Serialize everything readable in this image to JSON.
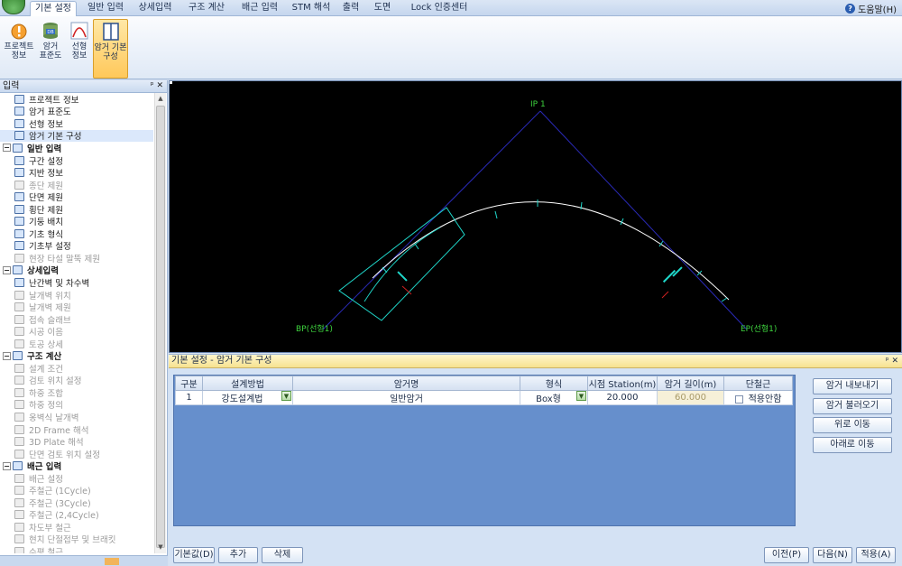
{
  "tabs": [
    "기본 설정",
    "일반 입력",
    "상세입력",
    "구조 계산",
    "배근 입력",
    "STM 해석",
    "출력",
    "도면",
    "Lock 인증센터"
  ],
  "help": {
    "label": "도움말(H)"
  },
  "ribbon": {
    "buttons": [
      {
        "line1": "프로젝트",
        "line2": "정보",
        "icon": "project-info-icon"
      },
      {
        "line1": "암거",
        "line2": "표준도",
        "icon": "database-icon"
      },
      {
        "line1": "선형",
        "line2": "정보",
        "icon": "curve-icon"
      },
      {
        "line1": "암거 기본",
        "line2": "구성",
        "icon": "box-frame-icon"
      }
    ]
  },
  "left_panel": {
    "title": "입력",
    "pin": "ᵖ ✕",
    "items": [
      {
        "label": "프로젝트 정보",
        "type": "child",
        "state": "normal"
      },
      {
        "label": "암거 표준도",
        "type": "child",
        "state": "normal"
      },
      {
        "label": "선형 정보",
        "type": "child",
        "state": "normal"
      },
      {
        "label": "암거 기본 구성",
        "type": "child",
        "state": "selected"
      },
      {
        "label": "일반 입력",
        "type": "group"
      },
      {
        "label": "구간 설정",
        "type": "child",
        "state": "normal"
      },
      {
        "label": "지반 정보",
        "type": "child",
        "state": "normal"
      },
      {
        "label": "종단 제원",
        "type": "child",
        "state": "disabled"
      },
      {
        "label": "단면 제원",
        "type": "child",
        "state": "normal"
      },
      {
        "label": "횡단 제원",
        "type": "child",
        "state": "normal"
      },
      {
        "label": "기둥 배치",
        "type": "child",
        "state": "normal"
      },
      {
        "label": "기초 형식",
        "type": "child",
        "state": "normal"
      },
      {
        "label": "기초부 설정",
        "type": "child",
        "state": "normal"
      },
      {
        "label": "현장 타설 말뚝 제원",
        "type": "child",
        "state": "disabled"
      },
      {
        "label": "상세입력",
        "type": "group"
      },
      {
        "label": "난간벽 및 차수벽",
        "type": "child",
        "state": "normal"
      },
      {
        "label": "날개벽 위치",
        "type": "child",
        "state": "disabled"
      },
      {
        "label": "날개벽 제원",
        "type": "child",
        "state": "disabled"
      },
      {
        "label": "접속 슬래브",
        "type": "child",
        "state": "disabled"
      },
      {
        "label": "시공 이음",
        "type": "child",
        "state": "disabled"
      },
      {
        "label": "토공 상세",
        "type": "child",
        "state": "disabled"
      },
      {
        "label": "구조 계산",
        "type": "group"
      },
      {
        "label": "설계 조건",
        "type": "child",
        "state": "disabled"
      },
      {
        "label": "검토 위치 설정",
        "type": "child",
        "state": "disabled"
      },
      {
        "label": "하중 조합",
        "type": "child",
        "state": "disabled"
      },
      {
        "label": "하중 정의",
        "type": "child",
        "state": "disabled"
      },
      {
        "label": "옹벽식 날개벽",
        "type": "child",
        "state": "disabled"
      },
      {
        "label": "2D Frame 해석",
        "type": "child",
        "state": "disabled"
      },
      {
        "label": "3D Plate 해석",
        "type": "child",
        "state": "disabled"
      },
      {
        "label": "단면 검토 위치 설정",
        "type": "child",
        "state": "disabled"
      },
      {
        "label": "배근 입력",
        "type": "group"
      },
      {
        "label": "배근 설정",
        "type": "child",
        "state": "disabled"
      },
      {
        "label": "주철근 (1Cycle)",
        "type": "child",
        "state": "disabled"
      },
      {
        "label": "주철근 (3Cycle)",
        "type": "child",
        "state": "disabled"
      },
      {
        "label": "주철근 (2,4Cycle)",
        "type": "child",
        "state": "disabled"
      },
      {
        "label": "차도부 철근",
        "type": "child",
        "state": "disabled"
      },
      {
        "label": "현치 단절접부 및 브래킷",
        "type": "child",
        "state": "disabled"
      },
      {
        "label": "수평 철근",
        "type": "child",
        "state": "disabled"
      }
    ]
  },
  "viewport": {
    "labels": {
      "ip": "IP 1",
      "bp": "BP(선형1)",
      "ep": "EP(선형1)"
    }
  },
  "bottom_panel": {
    "title": "기본 설정 - 암거 기본 구성",
    "pin": "ᵖ ✕",
    "columns": [
      "구분",
      "설계방법",
      "암거명",
      "형식",
      "시점 Station(m)",
      "암거 길이(m)",
      "단철근"
    ],
    "rows": [
      {
        "no": "1",
        "method": "강도설계법",
        "name": "일반암거",
        "type": "Box형",
        "station": "20.000",
        "length": "60.000",
        "rebar": "적용안함"
      }
    ],
    "side_buttons": [
      "암거 내보내기",
      "암거 불러오기",
      "위로 이동",
      "아래로 이동"
    ],
    "bottom_buttons": {
      "default": "기본값(D)",
      "add": "추가",
      "delete": "삭제",
      "prev": "이전(P)",
      "next": "다음(N)",
      "apply": "적용(A)"
    }
  },
  "colors": {
    "alignment_line": "#2a2ab8",
    "arc": "#ffffff",
    "culvert_outline": "#1fd6c9",
    "label_green": "#3ed33e",
    "selected_ribbon": "#ffc85a"
  }
}
